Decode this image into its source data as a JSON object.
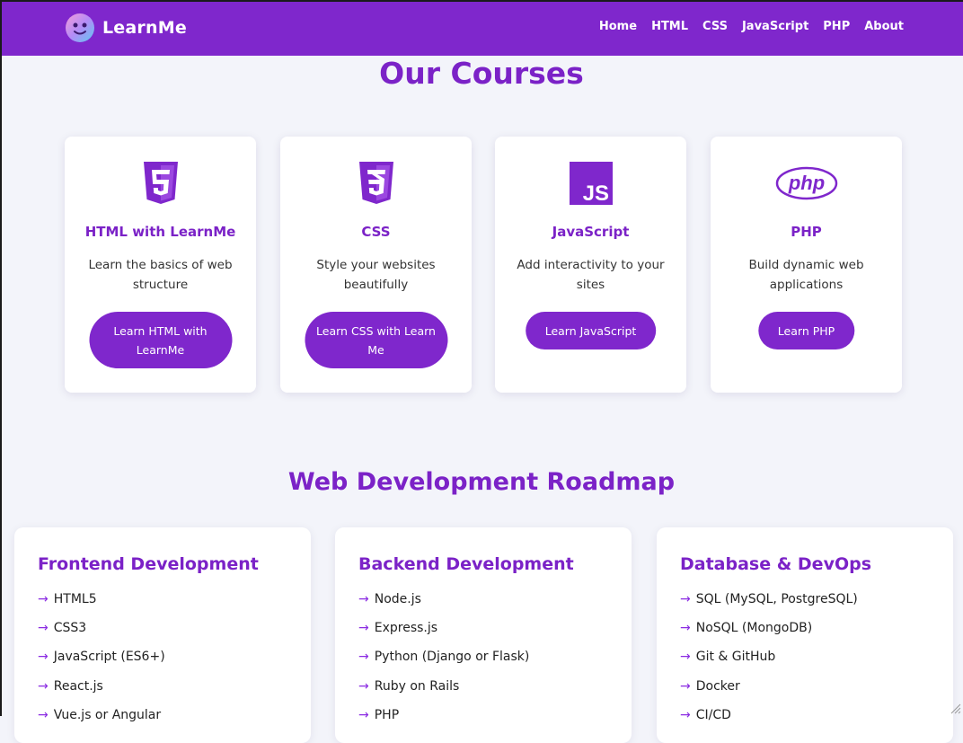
{
  "colors": {
    "brand": "#7f27cc",
    "heading": "#7b22c7",
    "background": "#f3f4fa"
  },
  "nav": {
    "brand": "LearnMe",
    "links": [
      "Home",
      "HTML",
      "CSS",
      "JavaScript",
      "PHP",
      "About"
    ]
  },
  "courses": {
    "title": "Our Courses",
    "items": [
      {
        "icon": "html5-icon",
        "name": "HTML with LearnMe",
        "desc": "Learn the basics of web structure",
        "button": "Learn HTML with LearnMe"
      },
      {
        "icon": "css3-icon",
        "name": "CSS",
        "desc": "Style your websites beautifully",
        "button": "Learn CSS with Learn Me"
      },
      {
        "icon": "js-icon",
        "name": "JavaScript",
        "desc": "Add interactivity to your sites",
        "button": "Learn JavaScript"
      },
      {
        "icon": "php-icon",
        "name": "PHP",
        "desc": "Build dynamic web applications",
        "button": "Learn PHP"
      }
    ]
  },
  "roadmap": {
    "title": "Web Development Roadmap",
    "arrow": "→",
    "columns": [
      {
        "title": "Frontend Development",
        "items": [
          "HTML5",
          "CSS3",
          "JavaScript (ES6+)",
          "React.js",
          "Vue.js or Angular"
        ]
      },
      {
        "title": "Backend Development",
        "items": [
          "Node.js",
          "Express.js",
          "Python (Django or Flask)",
          "Ruby on Rails",
          "PHP"
        ]
      },
      {
        "title": "Database & DevOps",
        "items": [
          "SQL (MySQL, PostgreSQL)",
          "NoSQL (MongoDB)",
          "Git & GitHub",
          "Docker",
          "CI/CD"
        ]
      }
    ]
  }
}
